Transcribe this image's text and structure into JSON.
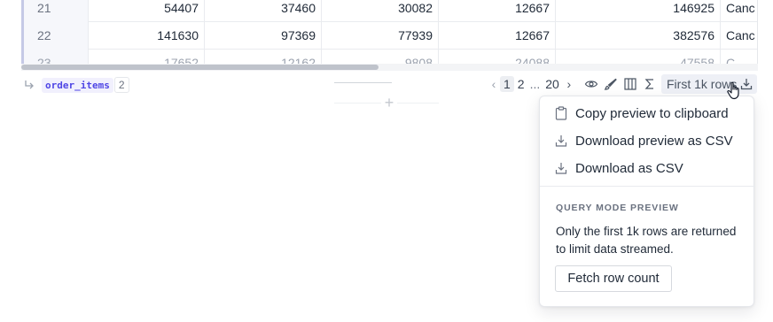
{
  "table": {
    "rows": [
      {
        "index": "21",
        "cells": [
          "54407",
          "37460",
          "30082",
          "12667",
          "146925",
          "Canc"
        ]
      },
      {
        "index": "22",
        "cells": [
          "141630",
          "97369",
          "77939",
          "12667",
          "382576",
          "Canc"
        ]
      },
      {
        "index": "23",
        "cells": [
          "17652",
          "12162",
          "9808",
          "24088",
          "47558",
          "C"
        ]
      }
    ]
  },
  "status": {
    "variable_name": "order_items",
    "variable_count": "2",
    "pager": {
      "prev_icon": "chevron-left-icon",
      "pages": [
        "1",
        "2"
      ],
      "ellipsis": "...",
      "last_page": "20",
      "next_icon": "chevron-right-icon"
    },
    "rows_button_label": "First 1k rows"
  },
  "menu": {
    "items": [
      {
        "label": "Copy preview to clipboard",
        "icon": "clipboard-icon"
      },
      {
        "label": "Download preview as CSV",
        "icon": "download-icon"
      },
      {
        "label": "Download as CSV",
        "icon": "download-icon"
      }
    ],
    "section_title": "QUERY MODE PREVIEW",
    "section_description": "Only the first 1k rows are returned to limit data streamed.",
    "fetch_button_label": "Fetch row count"
  },
  "colors": {
    "accent": "#4f46e5",
    "index_column_bg": "#f6f7fb",
    "active_page_bg": "#eceef2"
  }
}
